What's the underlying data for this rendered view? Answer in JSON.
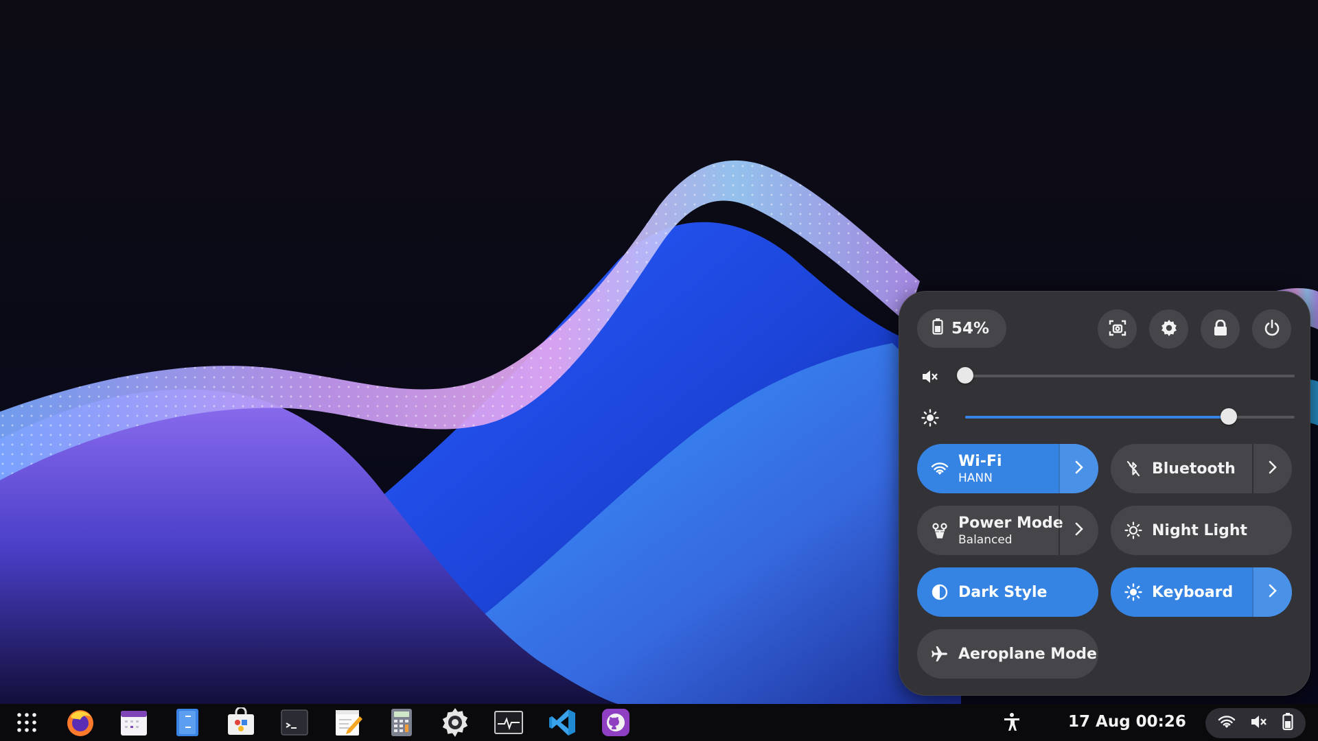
{
  "quick_settings": {
    "battery_percent": "54%",
    "volume_level": 0.0,
    "brightness_level": 0.8,
    "tiles": {
      "wifi": {
        "title": "Wi-Fi",
        "subtitle": "HANN",
        "active": true
      },
      "bluetooth": {
        "title": "Bluetooth",
        "active": false
      },
      "power_mode": {
        "title": "Power Mode",
        "subtitle": "Balanced",
        "active": false
      },
      "night_light": {
        "title": "Night Light",
        "active": false
      },
      "dark_style": {
        "title": "Dark Style",
        "active": true
      },
      "keyboard": {
        "title": "Keyboard",
        "active": true
      },
      "aeroplane_mode": {
        "title": "Aeroplane Mode",
        "active": false
      }
    },
    "buttons": [
      "screenshot-icon",
      "settings-icon",
      "lock-icon",
      "power-icon"
    ]
  },
  "taskbar": {
    "apps": [
      "app-grid-icon",
      "firefox-icon",
      "calendar-icon",
      "files-icon",
      "software-icon",
      "terminal-icon",
      "text-editor-icon",
      "calculator-icon",
      "settings-icon",
      "system-monitor-icon",
      "vscode-icon",
      "github-desktop-icon"
    ],
    "clock": "17 Aug  00:26",
    "tray": [
      "wifi-icon",
      "volume-muted-icon",
      "battery-icon"
    ]
  },
  "colors": {
    "accent": "#3584e4",
    "panel": "#333337",
    "tile": "#45454a",
    "taskbar": "#0a0a0c"
  }
}
